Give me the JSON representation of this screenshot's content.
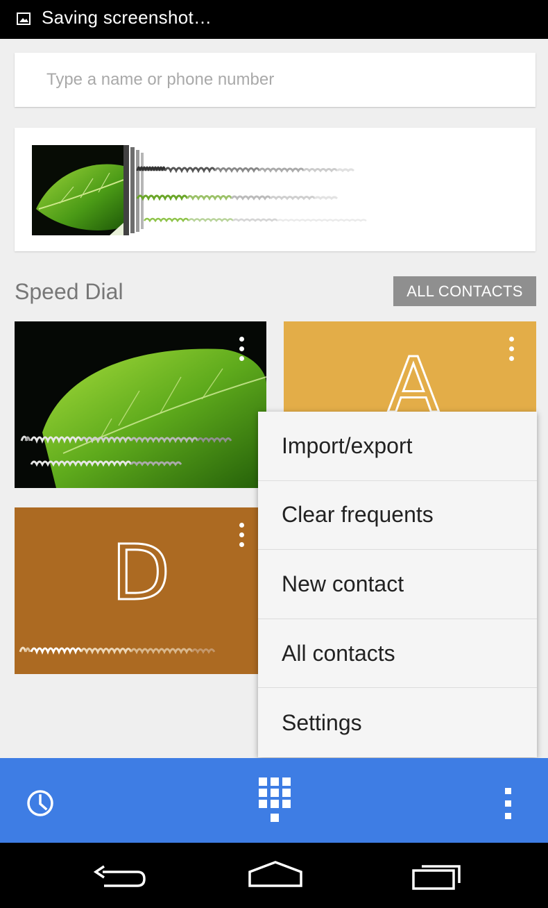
{
  "status_bar": {
    "notification_icon": "image-icon",
    "text": "Saving screenshot…"
  },
  "search": {
    "placeholder": "Type a name or phone number"
  },
  "speed_dial": {
    "title": "Speed Dial",
    "all_contacts_label": "ALL CONTACTS",
    "tiles": [
      {
        "letter": "",
        "color": "#050805",
        "type": "photo"
      },
      {
        "letter": "A",
        "color": "#e3ad48",
        "type": "letter"
      },
      {
        "letter": "D",
        "color": "#ac6a22",
        "type": "letter"
      }
    ]
  },
  "menu": {
    "items": [
      {
        "label": "Import/export"
      },
      {
        "label": "Clear frequents"
      },
      {
        "label": "New contact"
      },
      {
        "label": "All contacts"
      },
      {
        "label": "Settings"
      }
    ]
  },
  "action_bar": {
    "color": "#3e7de4",
    "icons": [
      "history-icon",
      "dialpad-icon",
      "overflow-menu-icon"
    ]
  },
  "nav_bar": {
    "icons": [
      "back-icon",
      "home-icon",
      "recents-icon"
    ]
  }
}
